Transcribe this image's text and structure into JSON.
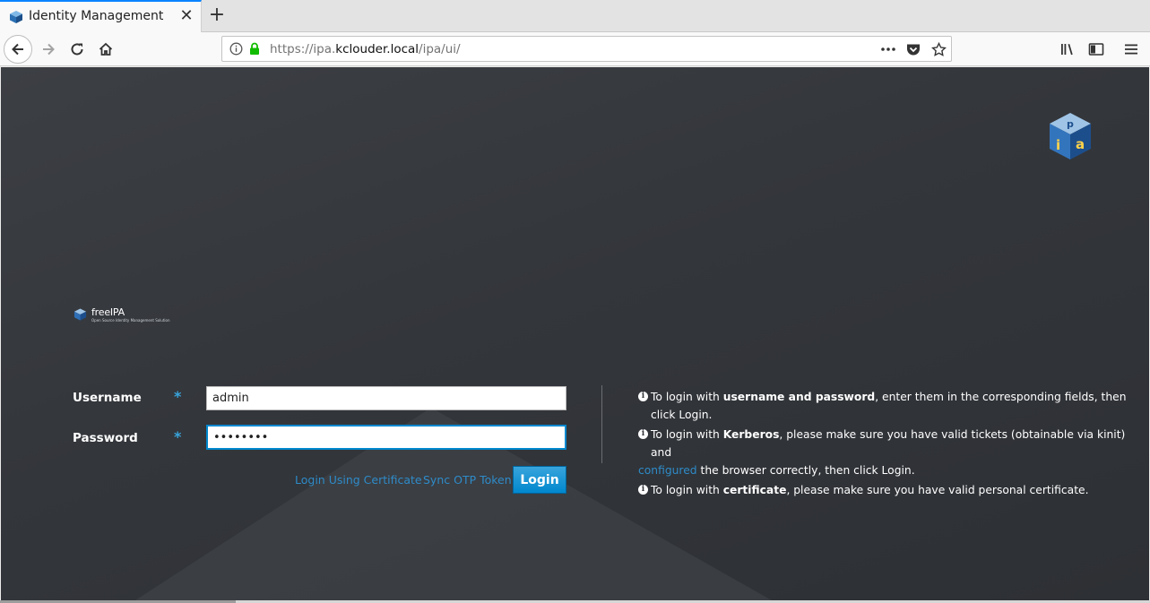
{
  "browser": {
    "tab_title": "Identity Management",
    "url_scheme_host_prefix": "https://ipa.",
    "url_host": "kclouder.local",
    "url_path": "/ipa/ui/"
  },
  "brand": {
    "name": "freeIPA",
    "subtitle": "Open Source Identity Management Solution"
  },
  "login": {
    "username_label": "Username",
    "password_label": "Password",
    "required_mark": "*",
    "username_value": "admin",
    "password_value": "Secret12",
    "cert_link": "Login Using Certificate",
    "otp_link": "Sync OTP Token",
    "login_button": "Login"
  },
  "help": {
    "info_icon": "i",
    "line1_pre": "To login with ",
    "line1_bold": "username and password",
    "line1_post": ", enter them in the corresponding fields, then click Login.",
    "line2_pre": "To login with ",
    "line2_bold": "Kerberos",
    "line2_post": ", please make sure you have valid tickets (obtainable via kinit) and ",
    "line2_link": "configured",
    "line2_end": " the browser correctly, then click Login.",
    "line3_pre": "To login with ",
    "line3_bold": "certificate",
    "line3_post": ", please make sure you have valid personal certificate."
  },
  "colors": {
    "accent": "#0088ce",
    "link": "#2e8bc9",
    "page_bg": "#33363b"
  }
}
